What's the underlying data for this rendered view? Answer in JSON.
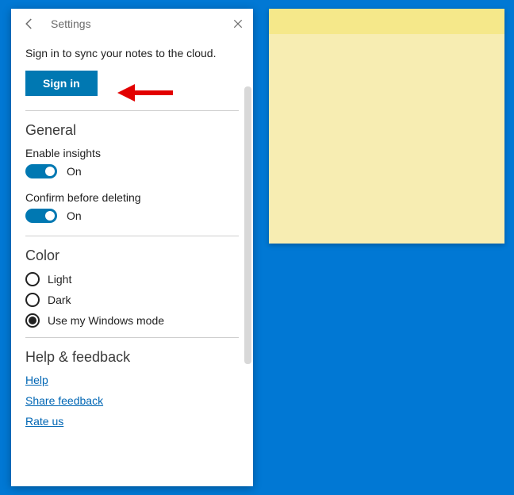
{
  "title": "Settings",
  "sync_text": "Sign in to sync your notes to the cloud.",
  "signin_label": "Sign in",
  "sections": {
    "general": {
      "title": "General",
      "insights": {
        "label": "Enable insights",
        "state": "On"
      },
      "confirm": {
        "label": "Confirm before deleting",
        "state": "On"
      }
    },
    "color": {
      "title": "Color",
      "options": {
        "light": "Light",
        "dark": "Dark",
        "windows": "Use my Windows mode"
      }
    },
    "help": {
      "title": "Help & feedback",
      "help_link": "Help",
      "share_link": "Share feedback",
      "rate_link": "Rate us"
    }
  },
  "colors": {
    "accent": "#0078b2",
    "desktop": "#0178d4",
    "note": "#f7edb2"
  }
}
